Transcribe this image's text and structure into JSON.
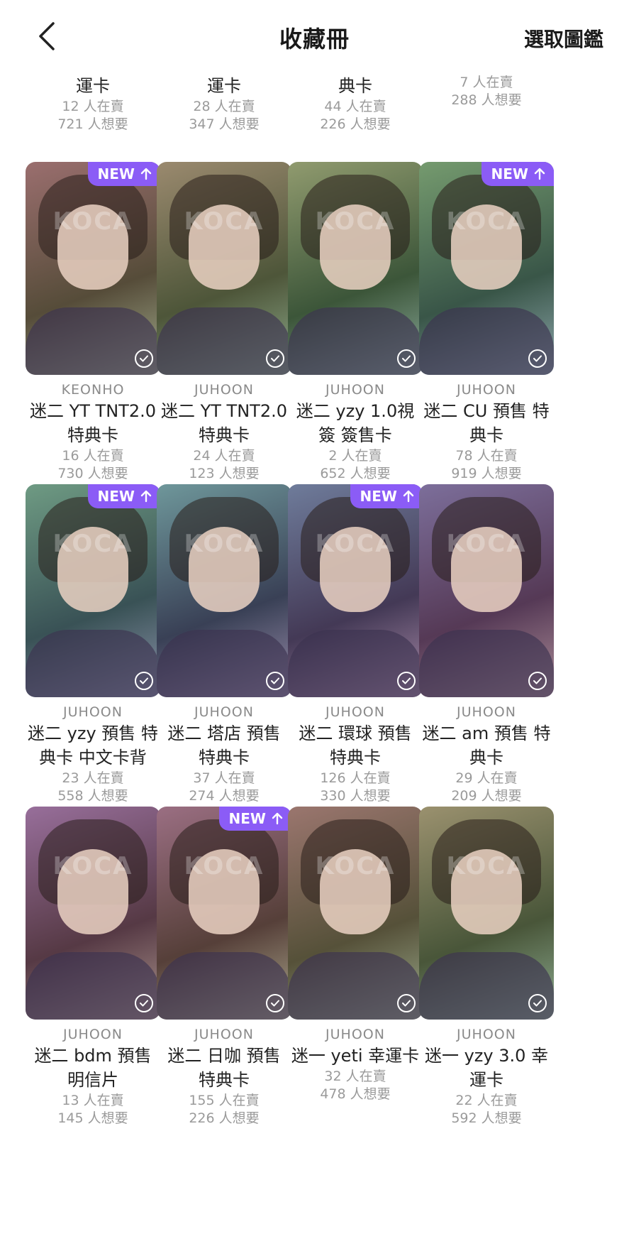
{
  "header": {
    "title": "收藏冊",
    "right_action": "選取圖鑑"
  },
  "partial_row": [
    {
      "name_tail": "運卡",
      "sellers": "12 人在賣",
      "wanted": "721 人想要"
    },
    {
      "name_tail": "運卡",
      "sellers": "28 人在賣",
      "wanted": "347 人想要"
    },
    {
      "name_tail": "典卡",
      "sellers": "44 人在賣",
      "wanted": "226 人想要"
    },
    {
      "name_tail": "",
      "sellers": "7 人在賣",
      "wanted": "288 人想要"
    }
  ],
  "cards": [
    {
      "artist": "KEONHO",
      "name": "迷二 YT TNT2.0 特典卡",
      "sellers": "16 人在賣",
      "wanted": "730 人想要",
      "new": true
    },
    {
      "artist": "JUHOON",
      "name": "迷二 YT TNT2.0 特典卡",
      "sellers": "24 人在賣",
      "wanted": "123 人想要",
      "new": false
    },
    {
      "artist": "JUHOON",
      "name": "迷二 yzy 1.0視簽 簽售卡",
      "sellers": "2 人在賣",
      "wanted": "652 人想要",
      "new": false
    },
    {
      "artist": "JUHOON",
      "name": "迷二 CU 預售 特典卡",
      "sellers": "78 人在賣",
      "wanted": "919 人想要",
      "new": true
    },
    {
      "artist": "JUHOON",
      "name": "迷二 yzy 預售 特典卡 中文卡背",
      "sellers": "23 人在賣",
      "wanted": "558 人想要",
      "new": true
    },
    {
      "artist": "JUHOON",
      "name": "迷二 塔店 預售 特典卡",
      "sellers": "37 人在賣",
      "wanted": "274 人想要",
      "new": false
    },
    {
      "artist": "JUHOON",
      "name": "迷二 環球 預售 特典卡",
      "sellers": "126 人在賣",
      "wanted": "330 人想要",
      "new": true
    },
    {
      "artist": "JUHOON",
      "name": "迷二 am 預售 特典卡",
      "sellers": "29 人在賣",
      "wanted": "209 人想要",
      "new": false
    },
    {
      "artist": "JUHOON",
      "name": "迷二 bdm 預售 明信片",
      "sellers": "13 人在賣",
      "wanted": "145 人想要",
      "new": false
    },
    {
      "artist": "JUHOON",
      "name": "迷二 日咖 預售 特典卡",
      "sellers": "155 人在賣",
      "wanted": "226 人想要",
      "new": true
    },
    {
      "artist": "JUHOON",
      "name": "迷一 yeti 幸運卡",
      "sellers": "32 人在賣",
      "wanted": "478 人想要",
      "new": false
    },
    {
      "artist": "JUHOON",
      "name": "迷一 yzy 3.0 幸運卡",
      "sellers": "22 人在賣",
      "wanted": "592 人想要",
      "new": false
    }
  ],
  "badge_label": "NEW",
  "watermark": "KOCA",
  "colors": {
    "badge": "#8b5cf6",
    "text_secondary": "#9a9a9a"
  },
  "icons": {
    "back": "chevron-left-icon",
    "new": "arrow-up-icon",
    "owned": "check-circle-icon"
  }
}
